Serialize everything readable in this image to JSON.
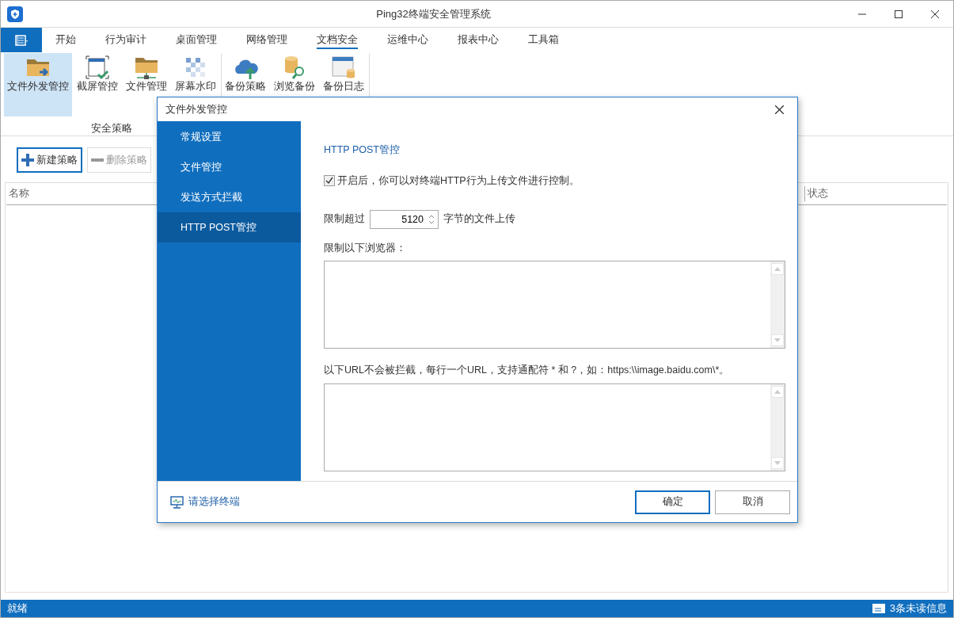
{
  "window": {
    "title": "Ping32终端安全管理系统"
  },
  "menu_tabs": [
    {
      "label": "开始",
      "selected": false
    },
    {
      "label": "行为审计",
      "selected": false
    },
    {
      "label": "桌面管理",
      "selected": false
    },
    {
      "label": "网络管理",
      "selected": false
    },
    {
      "label": "文档安全",
      "selected": true
    },
    {
      "label": "运维中心",
      "selected": false
    },
    {
      "label": "报表中心",
      "selected": false
    },
    {
      "label": "工具箱",
      "selected": false
    }
  ],
  "ribbon": {
    "groups": [
      {
        "label": "安全策略",
        "items": [
          {
            "label": "文件外发管控",
            "selected": true
          },
          {
            "label": "截屏管控",
            "selected": false
          },
          {
            "label": "文件管理",
            "selected": false
          },
          {
            "label": "屏幕水印",
            "selected": false
          }
        ]
      },
      {
        "items": [
          {
            "label": "备份策略",
            "selected": false
          },
          {
            "label": "浏览备份",
            "selected": false
          },
          {
            "label": "备份日志",
            "selected": false
          }
        ]
      }
    ]
  },
  "toolbar": [
    {
      "label": "新建策略",
      "disabled": false
    },
    {
      "label": "删除策略",
      "disabled": true
    }
  ],
  "table": {
    "columns": [
      "名称",
      "状态"
    ]
  },
  "status_bar": {
    "text": "就绪",
    "messages": "3条未读信息"
  },
  "dialog": {
    "title": "文件外发管控",
    "nav": [
      {
        "label": "常规设置",
        "selected": false
      },
      {
        "label": "文件管控",
        "selected": false
      },
      {
        "label": "发送方式拦截",
        "selected": false
      },
      {
        "label": "HTTP POST管控",
        "selected": true
      }
    ],
    "heading": "HTTP POST管控",
    "enable": {
      "label": "开启后，你可以对终端HTTP行为上传文件进行控制。",
      "checked": true
    },
    "limit": {
      "prefix": "限制超过",
      "value": "5120",
      "suffix": "字节的文件上传"
    },
    "browsers": {
      "label": "限制以下浏览器："
    },
    "whitelist": {
      "label": "以下URL不会被拦截，每行一个URL，支持通配符 * 和 ?，如：https:\\\\image.baidu.com\\*。"
    },
    "select_terminal": "请选择终端",
    "buttons": [
      {
        "label": "确定",
        "kind": "primary"
      },
      {
        "label": "取消",
        "kind": "secondary"
      }
    ]
  }
}
